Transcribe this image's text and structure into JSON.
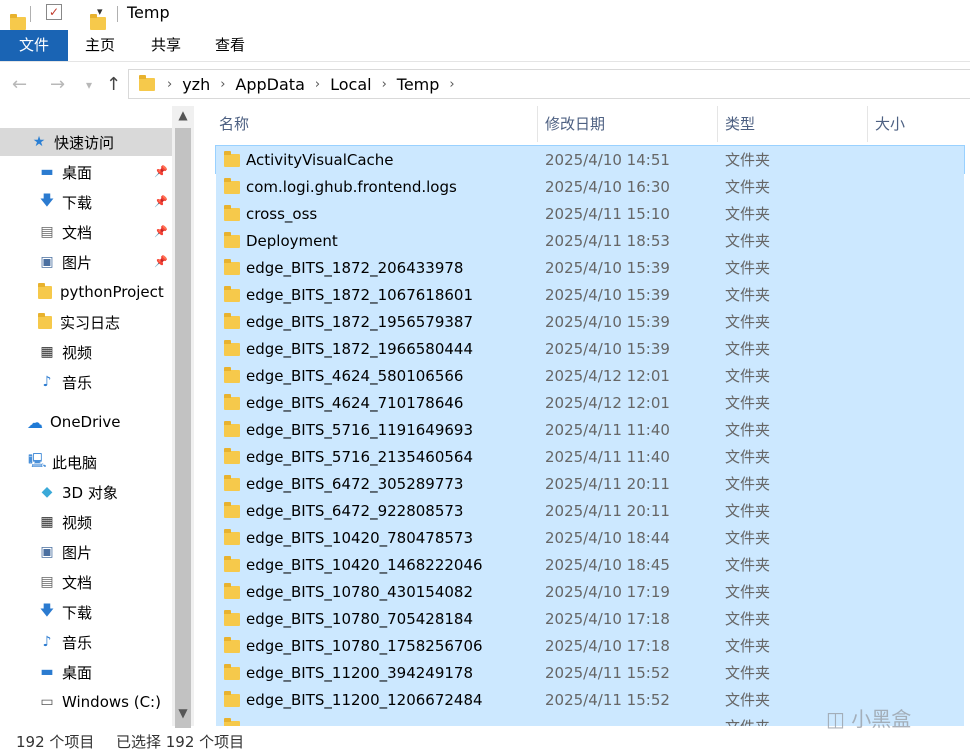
{
  "window": {
    "title": "Temp"
  },
  "ribbon": {
    "tabs": [
      "文件",
      "主页",
      "共享",
      "查看"
    ]
  },
  "address": {
    "segments": [
      "yzh",
      "AppData",
      "Local",
      "Temp"
    ]
  },
  "sidebar": {
    "quick_access": "快速访问",
    "items": [
      {
        "label": "桌面",
        "icon": "desktop-icon",
        "pinned": true
      },
      {
        "label": "下载",
        "icon": "download-icon",
        "pinned": true
      },
      {
        "label": "文档",
        "icon": "document-icon",
        "pinned": true
      },
      {
        "label": "图片",
        "icon": "picture-icon",
        "pinned": true
      },
      {
        "label": "pythonProject",
        "icon": "folder-icon",
        "pinned": false
      },
      {
        "label": "实习日志",
        "icon": "folder-icon",
        "pinned": false
      },
      {
        "label": "视频",
        "icon": "video-icon",
        "pinned": false
      },
      {
        "label": "音乐",
        "icon": "music-icon",
        "pinned": false
      }
    ],
    "onedrive": "OneDrive",
    "this_pc": "此电脑",
    "pc_items": [
      {
        "label": "3D 对象",
        "icon": "3d-objects-icon"
      },
      {
        "label": "视频",
        "icon": "video-icon"
      },
      {
        "label": "图片",
        "icon": "picture-icon"
      },
      {
        "label": "文档",
        "icon": "document-icon"
      },
      {
        "label": "下载",
        "icon": "download-icon"
      },
      {
        "label": "音乐",
        "icon": "music-icon"
      },
      {
        "label": "桌面",
        "icon": "desktop-icon"
      },
      {
        "label": "Windows (C:)",
        "icon": "drive-icon"
      }
    ]
  },
  "columns": {
    "name": "名称",
    "date": "修改日期",
    "type": "类型",
    "size": "大小"
  },
  "files": [
    {
      "name": "ActivityVisualCache",
      "date": "2025/4/10 14:51",
      "type": "文件夹"
    },
    {
      "name": "com.logi.ghub.frontend.logs",
      "date": "2025/4/10 16:30",
      "type": "文件夹"
    },
    {
      "name": "cross_oss",
      "date": "2025/4/11 15:10",
      "type": "文件夹"
    },
    {
      "name": "Deployment",
      "date": "2025/4/11 18:53",
      "type": "文件夹"
    },
    {
      "name": "edge_BITS_1872_206433978",
      "date": "2025/4/10 15:39",
      "type": "文件夹"
    },
    {
      "name": "edge_BITS_1872_1067618601",
      "date": "2025/4/10 15:39",
      "type": "文件夹"
    },
    {
      "name": "edge_BITS_1872_1956579387",
      "date": "2025/4/10 15:39",
      "type": "文件夹"
    },
    {
      "name": "edge_BITS_1872_1966580444",
      "date": "2025/4/10 15:39",
      "type": "文件夹"
    },
    {
      "name": "edge_BITS_4624_580106566",
      "date": "2025/4/12 12:01",
      "type": "文件夹"
    },
    {
      "name": "edge_BITS_4624_710178646",
      "date": "2025/4/12 12:01",
      "type": "文件夹"
    },
    {
      "name": "edge_BITS_5716_1191649693",
      "date": "2025/4/11 11:40",
      "type": "文件夹"
    },
    {
      "name": "edge_BITS_5716_2135460564",
      "date": "2025/4/11 11:40",
      "type": "文件夹"
    },
    {
      "name": "edge_BITS_6472_305289773",
      "date": "2025/4/11 20:11",
      "type": "文件夹"
    },
    {
      "name": "edge_BITS_6472_922808573",
      "date": "2025/4/11 20:11",
      "type": "文件夹"
    },
    {
      "name": "edge_BITS_10420_780478573",
      "date": "2025/4/10 18:44",
      "type": "文件夹"
    },
    {
      "name": "edge_BITS_10420_1468222046",
      "date": "2025/4/10 18:45",
      "type": "文件夹"
    },
    {
      "name": "edge_BITS_10780_430154082",
      "date": "2025/4/10 17:19",
      "type": "文件夹"
    },
    {
      "name": "edge_BITS_10780_705428184",
      "date": "2025/4/10 17:18",
      "type": "文件夹"
    },
    {
      "name": "edge_BITS_10780_1758256706",
      "date": "2025/4/10 17:18",
      "type": "文件夹"
    },
    {
      "name": "edge_BITS_11200_394249178",
      "date": "2025/4/11 15:52",
      "type": "文件夹"
    },
    {
      "name": "edge_BITS_11200_1206672484",
      "date": "2025/4/11 15:52",
      "type": "文件夹"
    },
    {
      "name": "",
      "date": "",
      "type": "文件夹"
    }
  ],
  "status": {
    "count": "192 个项目",
    "selected": "已选择 192 个项目"
  },
  "watermark": "小黑盒",
  "colors": {
    "accent": "#1a64b4",
    "selection": "#cce8ff",
    "folder": "#f6c94b"
  }
}
